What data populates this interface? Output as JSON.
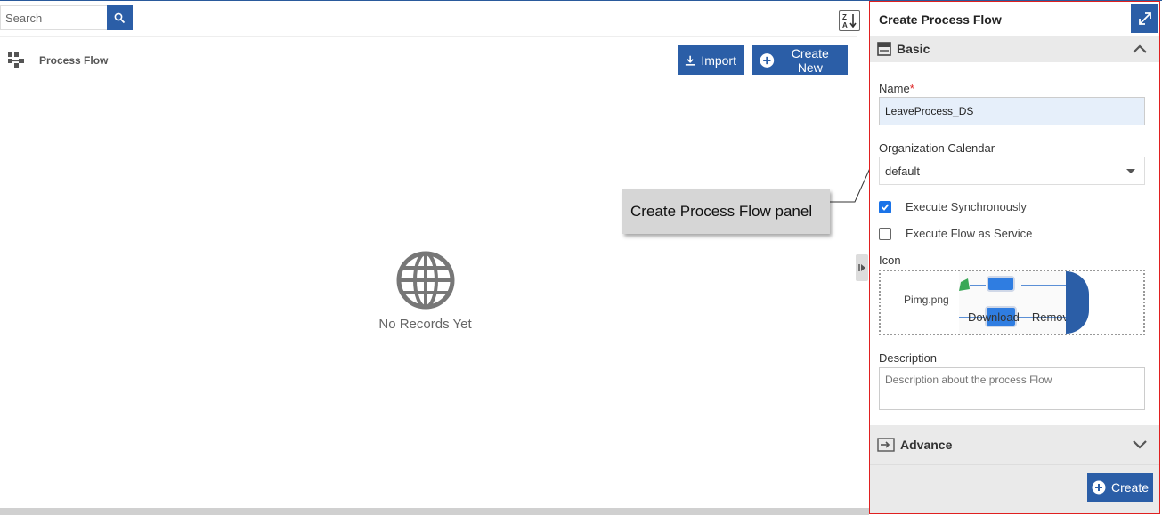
{
  "search": {
    "placeholder": "Search"
  },
  "list": {
    "title": "Process Flow",
    "import_label": "Import",
    "create_new_label": "Create New",
    "empty_text": "No Records Yet"
  },
  "callout": {
    "text": "Create Process Flow panel"
  },
  "panel": {
    "title": "Create Process Flow",
    "basic_label": "Basic",
    "name_label": "Name",
    "name_required": "*",
    "name_value": "LeaveProcess_DS",
    "calendar_label": "Organization Calendar",
    "calendar_value": "default",
    "exec_sync_label": "Execute Synchronously",
    "exec_sync_checked": true,
    "exec_service_label": "Execute Flow as Service",
    "exec_service_checked": false,
    "icon_label": "Icon",
    "icon_filename": "Pimg.png",
    "download_label": "Download",
    "remove_label": "Remove",
    "description_label": "Description",
    "description_placeholder": "Description about the process Flow",
    "advance_label": "Advance",
    "create_label": "Create"
  },
  "colors": {
    "accent": "#2b5ea7",
    "panel_border": "#e02020",
    "checkbox": "#1a73e8"
  }
}
